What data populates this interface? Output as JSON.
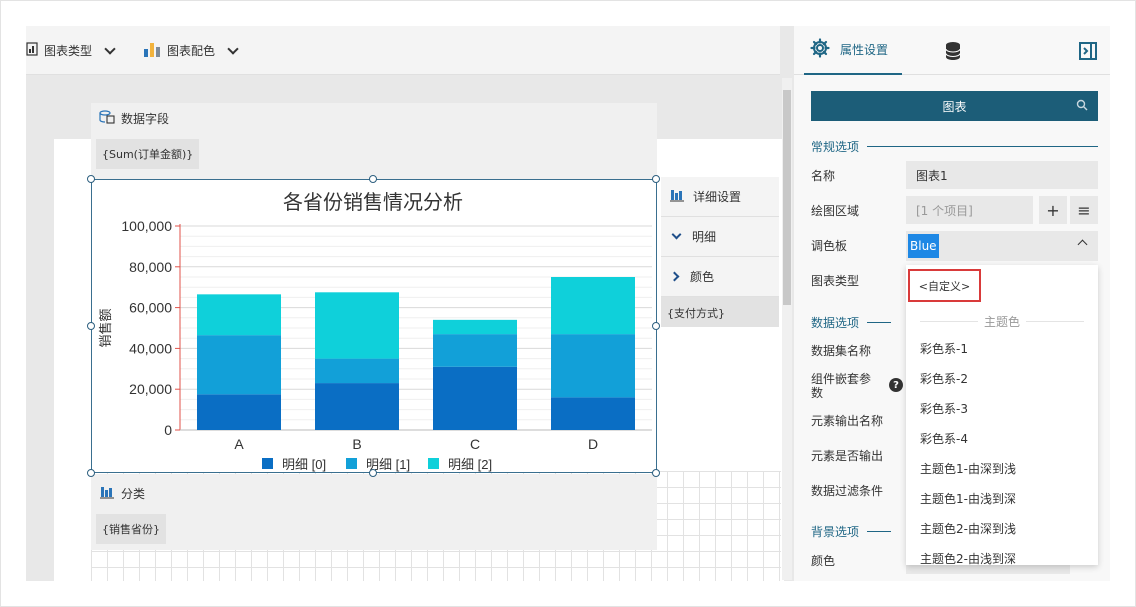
{
  "toolbar": {
    "chart_type_label": "图表类型",
    "chart_color_label": "图表配色"
  },
  "zones": {
    "data_field_title": "数据字段",
    "data_field_chip": "{Sum(订单金额)}",
    "category_title": "分类",
    "category_chip": "{销售省份}",
    "detail_title": "详细设置",
    "detail_item": "明细",
    "color_item": "颜色",
    "color_chip": "{支付方式}"
  },
  "chart_data": {
    "type": "bar",
    "stacked": true,
    "title": "各省份销售情况分析",
    "xlabel": "",
    "ylabel": "销售额",
    "categories": [
      "A",
      "B",
      "C",
      "D"
    ],
    "ylim": [
      0,
      100000
    ],
    "yticks": [
      "0",
      "20,000",
      "40,000",
      "60,000",
      "80,000",
      "100,000"
    ],
    "series": [
      {
        "name": "明细 [0]",
        "color": "#0a6ec4",
        "values": [
          17500,
          23000,
          31000,
          16000
        ]
      },
      {
        "name": "明细 [1]",
        "color": "#12a0d8",
        "values": [
          29000,
          12000,
          16000,
          31000
        ]
      },
      {
        "name": "明细 [2]",
        "color": "#0fd0da",
        "values": [
          20000,
          32500,
          7000,
          28000
        ]
      }
    ],
    "legend": "bottom",
    "grid": true
  },
  "panel": {
    "tab_properties": "属性设置",
    "search_title": "图表",
    "section_general": "常规选项",
    "section_data": "数据选项",
    "section_background": "背景选项",
    "name_label": "名称",
    "name_value": "图表1",
    "plot_area_label": "绘图区域",
    "plot_area_value": "[1 个项目]",
    "palette_label": "调色板",
    "palette_value": "Blue",
    "chart_type_label": "图表类型",
    "dataset_label": "数据集名称",
    "component_param_label_1": "组件嵌套参",
    "component_param_label_2": "数",
    "element_output_name_label": "元素输出名称",
    "element_output_label": "元素是否输出",
    "data_filter_label": "数据过滤条件",
    "color_label": "颜色"
  },
  "dropdown": {
    "custom": "<自定义>",
    "group_header": "主题色",
    "options": [
      "彩色系-1",
      "彩色系-2",
      "彩色系-3",
      "彩色系-4",
      "主题色1-由深到浅",
      "主题色1-由浅到深",
      "主题色2-由深到浅",
      "主题色2-由浅到深"
    ]
  },
  "colors": {
    "accent": "#1c5d78",
    "highlight": "#1e88e5",
    "custom_border": "#d93a3a"
  }
}
